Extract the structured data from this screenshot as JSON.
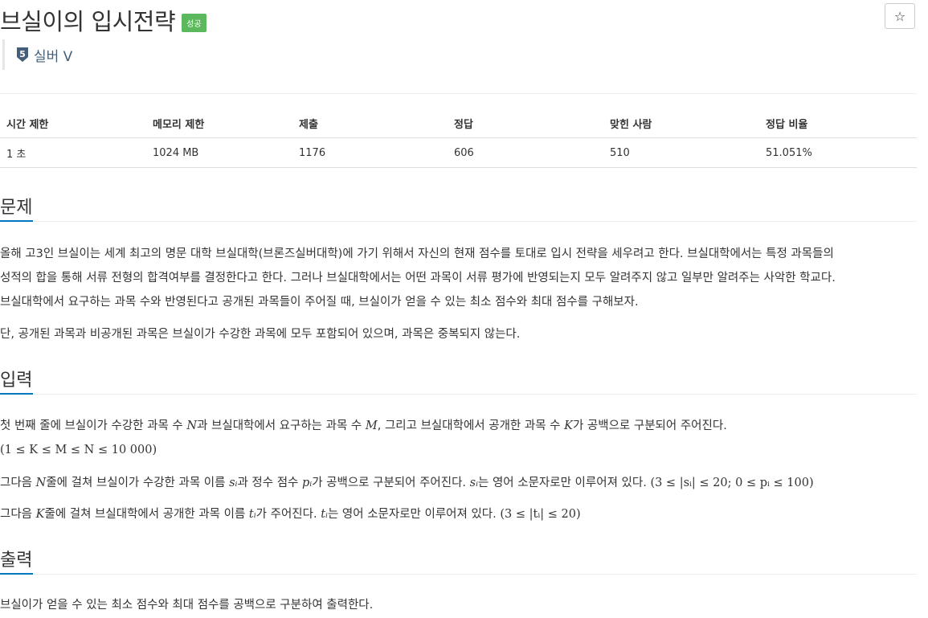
{
  "problem": {
    "title": "브실이의 입시전략",
    "status_badge": "성공",
    "tier": {
      "level": "5",
      "label": "실버 V"
    },
    "star_icon": "☆"
  },
  "stats": {
    "headers": [
      "시간 제한",
      "메모리 제한",
      "제출",
      "정답",
      "맞힌 사람",
      "정답 비율"
    ],
    "values": [
      "1 초",
      "1024 MB",
      "1176",
      "606",
      "510",
      "51.051%"
    ]
  },
  "sections": {
    "problem": {
      "heading": "문제",
      "lines": [
        "올해 고3인 브실이는 세계 최고의 명문 대학 브실대학(브론즈실버대학)에 가기 위해서 자신의 현재 점수를 토대로 입시 전략을 세우려고 한다. 브실대학에서는 특정 과목들의",
        "성적의 합을 통해 서류 전형의 합격여부를 결정한다고 한다. 그러나 브실대학에서는 어떤 과목이 서류 평가에 반영되는지 모두 알려주지 않고 일부만 알려주는 사악한 학교다.",
        "브실대학에서 요구하는 과목 수와 반영된다고 공개된 과목들이 주어질 때, 브실이가 얻을 수 있는 최소 점수와 최대 점수를 구해보자.",
        "단, 공개된 과목과 비공개된 과목은 브실이가 수강한 과목에 모두 포함되어 있으며, 과목은 중복되지 않는다."
      ]
    },
    "input": {
      "heading": "입력",
      "p1_a": "첫 번째 줄에 브실이가 수강한 과목 수 ",
      "p1_N": "N",
      "p1_b": "과 브실대학에서 요구하는 과목 수 ",
      "p1_M": "M",
      "p1_c": ", 그리고 브실대학에서 공개한 과목 수 ",
      "p1_K": "K",
      "p1_d": "가 공백으로 구분되어 주어진다.",
      "p1_math": "(1 ≤ K ≤ M ≤ N ≤ 10 000)",
      "p2_a": "그다음 ",
      "p2_N": "N",
      "p2_b": "줄에 걸쳐 브실이가 수강한 과목 이름 ",
      "p2_s": "sᵢ",
      "p2_c": "과 정수 점수 ",
      "p2_p": "pᵢ",
      "p2_d": "가 공백으로 구분되어 주어진다. ",
      "p2_s2": "sᵢ",
      "p2_e": "는 영어 소문자로만 이루어져 있다. ",
      "p2_math": "(3 ≤ |sᵢ| ≤ 20; 0 ≤ pᵢ ≤ 100)",
      "p3_a": "그다음 ",
      "p3_K": "K",
      "p3_b": "줄에 걸쳐 브실대학에서 공개한 과목 이름 ",
      "p3_t": "tᵢ",
      "p3_c": "가 주어진다. ",
      "p3_t2": "tᵢ",
      "p3_d": "는 영어 소문자로만 이루어져 있다. ",
      "p3_math": "(3 ≤ |tᵢ| ≤ 20)"
    },
    "output": {
      "heading": "출력",
      "line": "브실이가 얻을 수 있는 최소 점수와 최대 점수를 공백으로 구분하여 출력한다."
    }
  },
  "colors": {
    "badge_green": "#5cb85c",
    "heading_underline": "#0076c0",
    "tier_text": "#435f7a",
    "tier_icon": "#435f7a"
  }
}
